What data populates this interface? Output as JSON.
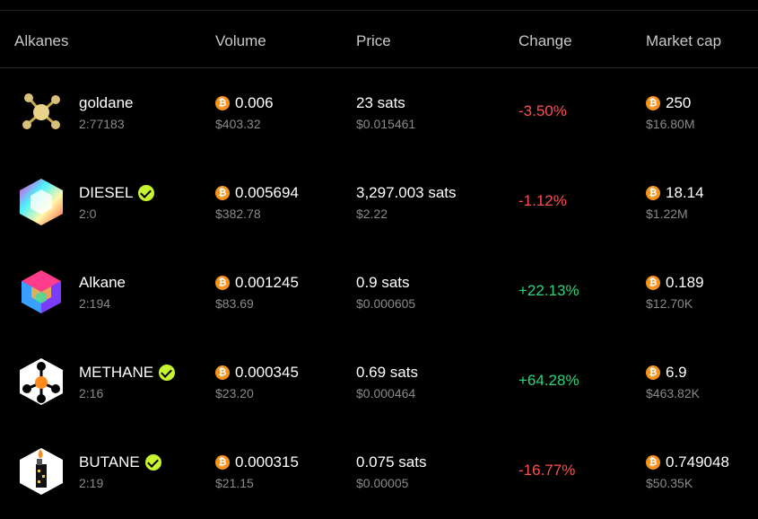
{
  "header": {
    "col_alkanes": "Alkanes",
    "col_volume": "Volume",
    "col_price": "Price",
    "col_change": "Change",
    "col_marketcap": "Market cap"
  },
  "currency_icon": "bitcoin-icon",
  "colors": {
    "negative": "#ff4d4f",
    "positive": "#2bd67b",
    "verified": "#c6f432",
    "btc": "#f7931a"
  },
  "rows": [
    {
      "name": "goldane",
      "id": "2:77183",
      "verified": false,
      "logo": "goldane-molecule-icon",
      "volume_btc": "0.006",
      "volume_usd": "$403.32",
      "price_sats": "23 sats",
      "price_usd": "$0.015461",
      "change": "-3.50%",
      "change_dir": "down",
      "mcap_btc": "250",
      "mcap_usd": "$16.80M"
    },
    {
      "name": "DIESEL",
      "id": "2:0",
      "verified": true,
      "logo": "diesel-hexagon-icon",
      "volume_btc": "0.005694",
      "volume_usd": "$382.78",
      "price_sats": "3,297.003 sats",
      "price_usd": "$2.22",
      "change": "-1.12%",
      "change_dir": "down",
      "mcap_btc": "18.14",
      "mcap_usd": "$1.22M"
    },
    {
      "name": "Alkane",
      "id": "2:194",
      "verified": false,
      "logo": "alkane-cube-icon",
      "volume_btc": "0.001245",
      "volume_usd": "$83.69",
      "price_sats": "0.9 sats",
      "price_usd": "$0.000605",
      "change": "+22.13%",
      "change_dir": "up",
      "mcap_btc": "0.189",
      "mcap_usd": "$12.70K"
    },
    {
      "name": "METHANE",
      "id": "2:16",
      "verified": true,
      "logo": "methane-molecule-icon",
      "volume_btc": "0.000345",
      "volume_usd": "$23.20",
      "price_sats": "0.69 sats",
      "price_usd": "$0.000464",
      "change": "+64.28%",
      "change_dir": "up",
      "mcap_btc": "6.9",
      "mcap_usd": "$463.82K"
    },
    {
      "name": "BUTANE",
      "id": "2:19",
      "verified": true,
      "logo": "butane-lighter-icon",
      "volume_btc": "0.000315",
      "volume_usd": "$21.15",
      "price_sats": "0.075 sats",
      "price_usd": "$0.00005",
      "change": "-16.77%",
      "change_dir": "down",
      "mcap_btc": "0.749048",
      "mcap_usd": "$50.35K"
    }
  ]
}
